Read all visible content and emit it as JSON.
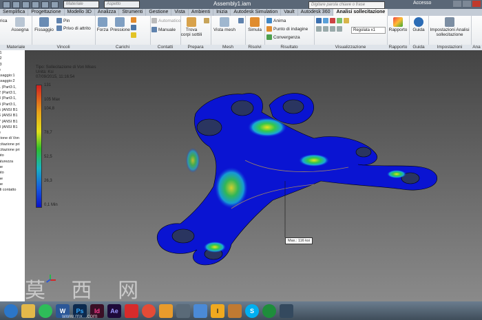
{
  "app": {
    "document_title": "Assembly1.iam",
    "search_placeholder": "Digitare parola chiave o frase",
    "signin_label": "Accesso",
    "material_combo": "Materiale",
    "appearance_combo": "Aspetto"
  },
  "tabs": [
    {
      "label": "Semplifica"
    },
    {
      "label": "Progettazione"
    },
    {
      "label": "Modello 3D"
    },
    {
      "label": "Analizza"
    },
    {
      "label": "Strumenti"
    },
    {
      "label": "Gestione"
    },
    {
      "label": "Vista"
    },
    {
      "label": "Ambienti"
    },
    {
      "label": "Inizia"
    },
    {
      "label": "Autodesk Simulation"
    },
    {
      "label": "Vault"
    },
    {
      "label": "Autodesk 360"
    },
    {
      "label": "Analisi sollecitazione",
      "active": true
    }
  ],
  "ribbon": {
    "materiale": {
      "label": "Materiale",
      "assign": "Assegna",
      "left": "rica"
    },
    "vincoli": {
      "label": "Vincoli",
      "fissaggio": "Fissaggio",
      "pin": "Pin",
      "privo": "Privo di attrito"
    },
    "carichi": {
      "label": "Carichi",
      "forza": "Forza",
      "pressione": "Pressione"
    },
    "contatti": {
      "label": "Contatti",
      "automatico": "Automatico",
      "manuale": "Manuale"
    },
    "prepara": {
      "label": "Prepara",
      "trova": "Trova corpi sottili"
    },
    "mesh": {
      "label": "Mesh",
      "vista": "Vista mesh"
    },
    "risolvi": {
      "label": "Risolvi",
      "simula": "Simula"
    },
    "risultato": {
      "label": "Risultato",
      "anima": "Anima",
      "punto": "Punto di indagine",
      "convergenza": "Convergenza"
    },
    "visualizzazione": {
      "label": "Visualizzazione",
      "scale": "Regolata x1"
    },
    "rapporto": {
      "label": "Rapporto",
      "btn": "Rapporto"
    },
    "guida": {
      "label": "Guida",
      "btn": "Guida"
    },
    "impostazioni": {
      "label": "Impostazioni",
      "btn": "Impostazioni Analisi sollecitazione"
    },
    "extra": {
      "label": "Ana"
    }
  },
  "browser": {
    "items": [
      "",
      ":1",
      ":2",
      ":3",
      "e",
      "",
      "ssaggio:1",
      "ssaggio:2",
      "",
      "",
      "",
      "",
      "",
      "",
      "",
      "1 (Part3:1,",
      "2 (Part3:1,",
      "3 (Part3:1,",
      "4 (Part3:1,",
      "5 (ANSI B1",
      "6 (ANSI B1",
      "7 (ANSI B1",
      "8 (ANSI B1",
      "e",
      "",
      "",
      "zione di Von",
      "icitazione pri",
      "icitazione pri",
      "nto",
      "",
      "aturezza",
      "ne",
      "nto",
      "ne",
      "ne",
      "di contatto"
    ]
  },
  "viewport": {
    "info": {
      "type": "Tipo: Sollecitazione di Von Mises",
      "unit": "Unità: Ksi",
      "date": "07/09/2015, 11:16:54"
    },
    "legend": [
      {
        "label": "131"
      },
      {
        "label": "105 Max"
      },
      {
        "label": "104,8"
      },
      {
        "label": "78,7"
      },
      {
        "label": "52,5"
      },
      {
        "label": "26,3"
      },
      {
        "label": "0,1 Min"
      }
    ],
    "probe_label": "Max.: 116 ksi"
  },
  "taskbar": {
    "icons": [
      "start-orb",
      "explorer",
      "spotify",
      "word",
      "photoshop",
      "indesign",
      "after-effects",
      "acrobat",
      "google-chrome",
      "inventor",
      "settings",
      "drive",
      "instructables",
      "app",
      "skype",
      "utorrent",
      "media"
    ]
  },
  "watermark": {
    "text": "莫 西 网",
    "url": "www.mx...com"
  },
  "colors": {
    "accent_tab": "#f7f7f7",
    "stress_max": "#d21f1f",
    "stress_min": "#0a12c8"
  }
}
